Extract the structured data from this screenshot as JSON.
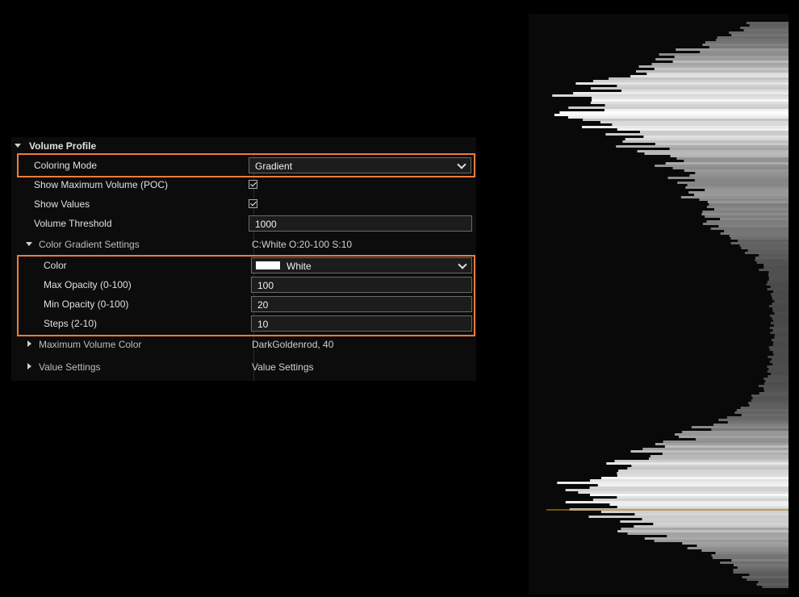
{
  "volume_profile": {
    "title": "Volume Profile",
    "rows": {
      "coloring_mode": {
        "label": "Coloring Mode",
        "value": "Gradient"
      },
      "show_poc": {
        "label": "Show Maximum Volume (POC)",
        "checked": true
      },
      "show_values": {
        "label": "Show Values",
        "checked": true
      },
      "volume_threshold": {
        "label": "Volume Threshold",
        "value": "1000"
      },
      "color_gradient": {
        "label": "Color Gradient Settings",
        "summary": "C:White O:20-100 S:10",
        "color": {
          "label": "Color",
          "value": "White",
          "swatch": "#ffffff"
        },
        "max_opacity": {
          "label": "Max Opacity (0-100)",
          "value": "100"
        },
        "min_opacity": {
          "label": "Min Opacity (0-100)",
          "value": "20"
        },
        "steps": {
          "label": "Steps (2-10)",
          "value": "10"
        }
      },
      "max_volume_color": {
        "label": "Maximum Volume Color",
        "value": "DarkGoldenrod, 40"
      },
      "value_settings": {
        "label": "Value Settings",
        "value": "Value Settings"
      }
    }
  },
  "colors": {
    "highlight": "#ee7c3a",
    "poc": "#b8860b",
    "panel_bg": "#0c0c0c"
  }
}
